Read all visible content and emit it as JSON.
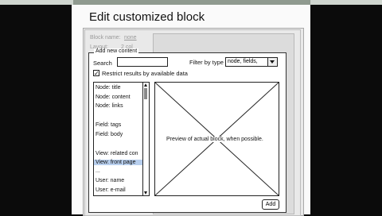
{
  "window": {
    "title": "Edit customized block"
  },
  "background_form": {
    "block_name_label": "Block name:",
    "block_name_value": "none",
    "layout_label": "Layout:",
    "layout_value": "2 col"
  },
  "dialog": {
    "legend": "Add new content",
    "search_label": "Search",
    "search_value": "",
    "filter_label": "Filter by type",
    "filter_value": "node, fields,",
    "restrict_checked": true,
    "restrict_label": "Restrict results by available data",
    "check_mark": "✓",
    "list_items": [
      "Node: title",
      "Node: content",
      "Node: links",
      "",
      "Field: tags",
      "Field: body",
      "",
      "View: related con",
      "View: front page",
      "...",
      "User: name",
      "User: e-mail"
    ],
    "selected_index": 8,
    "preview_text": "Preview of actual block, when possible.",
    "add_button": "Add"
  }
}
